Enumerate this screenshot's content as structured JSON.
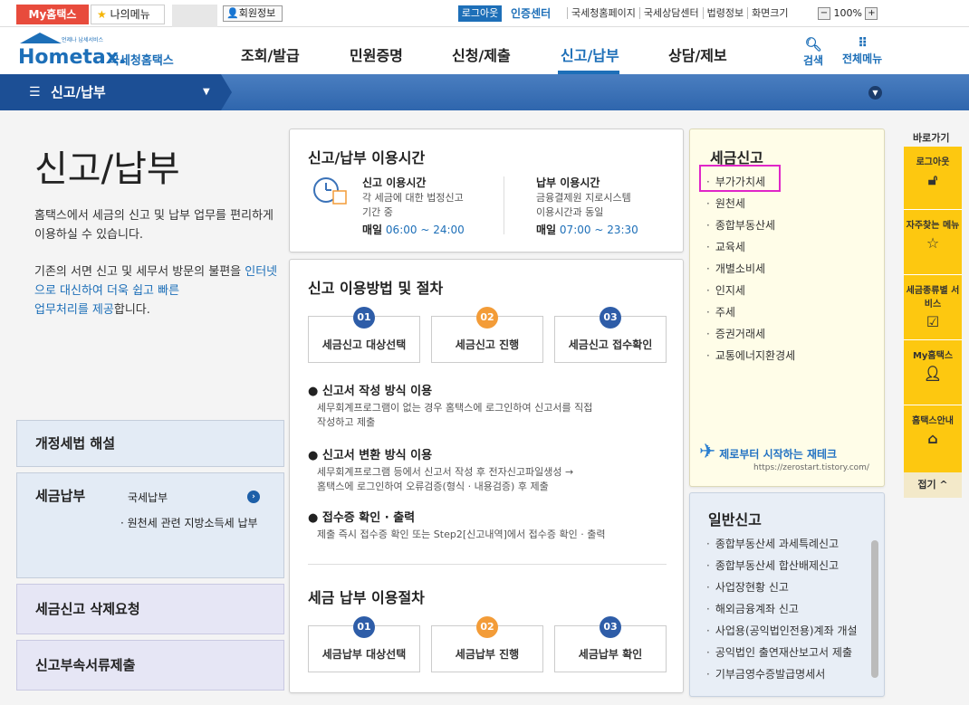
{
  "topbar": {
    "my_hometax": "My홈택스",
    "my_menu": "나의메뉴",
    "member_info": "회원정보",
    "logout": "로그아웃",
    "cert_center": "인증센터",
    "links": [
      "국세청홈페이지",
      "국세상담센터",
      "법령정보",
      "화면크기"
    ],
    "zoom_minus": "−",
    "zoom_value": "100%",
    "zoom_plus": "+"
  },
  "header": {
    "logo_small": "언제나 납세서비스",
    "logo_main": "Hometax.",
    "logo_sub": "국세청홈택스",
    "nav": [
      "조회/발급",
      "민원증명",
      "신청/제출",
      "신고/납부",
      "상담/제보"
    ],
    "active_nav": "신고/납부",
    "search_label": "검색",
    "allmenu_label": "전체메뉴"
  },
  "band": {
    "current": "신고/납부"
  },
  "left": {
    "title": "신고/납부",
    "desc1": "홈택스에서 세금의 신고 및 납부 업무를 편리하게 이용하실 수 있습니다.",
    "desc2_pre": "기존의 서면 신고 및 세무서 방문의 불편을 ",
    "desc2_hl1": "인터넷으로 대신하여 더욱 쉽고 빠른",
    "desc2_hl2": "업무처리를 제공",
    "desc2_post": "합니다.",
    "boxes": {
      "revision": "개정세법 해설",
      "payment": "세금납부",
      "payment_sub1": "국세납부",
      "payment_sub2": "· 원천세 관련 지방소득세 납부",
      "delete_request": "세금신고 삭제요청",
      "attach_submit": "신고부속서류제출"
    }
  },
  "hours": {
    "title": "신고/납부 이용시간",
    "report_title": "신고 이용시간",
    "report_desc1": "각 세금에 대한 법정신고",
    "report_desc2": "기간 중",
    "report_daily": "매일",
    "report_time": "06:00 ~ 24:00",
    "pay_title": "납부 이용시간",
    "pay_desc1": "금융결제원 지로시스템",
    "pay_desc2": "이용시간과 동일",
    "pay_daily": "매일",
    "pay_time": "07:00 ~ 23:30"
  },
  "procedure": {
    "title": "신고 이용방법 및 절차",
    "steps": [
      {
        "num": "01",
        "label": "세금신고 대상선택"
      },
      {
        "num": "02",
        "label": "세금신고 진행"
      },
      {
        "num": "03",
        "label": "세금신고 접수확인"
      }
    ],
    "sections": [
      {
        "head": "신고서 작성 방식 이용",
        "body1": "세무회계프로그램이 없는 경우 홈택스에 로그인하여 신고서를 직접",
        "body2": "작성하고 제출"
      },
      {
        "head": "신고서 변환 방식 이용",
        "body1": "세무회계프로그램 등에서 신고서 작성 후 전자신고파일생성 →",
        "body2": "홈택스에 로그인하여 오류검증(형식 · 내용검증) 후 제출"
      },
      {
        "head": "접수증 확인 · 출력",
        "body1": "제출 즉시 접수증 확인 또는 Step2[신고내역]에서 접수증 확인 · 출력",
        "body2": ""
      }
    ],
    "pay_title": "세금 납부 이용절차",
    "pay_steps": [
      {
        "num": "01",
        "label": "세금납부 대상선택"
      },
      {
        "num": "02",
        "label": "세금납부 진행"
      },
      {
        "num": "03",
        "label": "세금납부 확인"
      }
    ]
  },
  "tax_report": {
    "title": "세금신고",
    "items": [
      "부가가치세",
      "원천세",
      "종합부동산세",
      "교육세",
      "개별소비세",
      "인지세",
      "주세",
      "증권거래세",
      "교통에너지환경세"
    ],
    "watermark_main": "제로부터 시작하는 재테크",
    "watermark_url": "https://zerostart.tistory.com/"
  },
  "general_report": {
    "title": "일반신고",
    "items": [
      "종합부동산세 과세특례신고",
      "종합부동산세 합산배제신고",
      "사업장현황 신고",
      "해외금융계좌 신고",
      "사업용(공익법인전용)계좌 개설",
      "공익법인 출연재산보고서 제출",
      "기부금영수증발급명세서"
    ]
  },
  "quick": {
    "title": "바로가기",
    "items": [
      "로그아웃",
      "자주찾는 메뉴",
      "세금종류별 서비스",
      "My홈택스",
      "홈택스안내"
    ],
    "fold": "접기 ^"
  },
  "colors": {
    "brand_blue": "#1d6fb8",
    "band_blue": "#2f66ad",
    "my_red": "#e84b3c",
    "quick_yellow": "#fdc810",
    "highlight_magenta": "#e026c8"
  }
}
